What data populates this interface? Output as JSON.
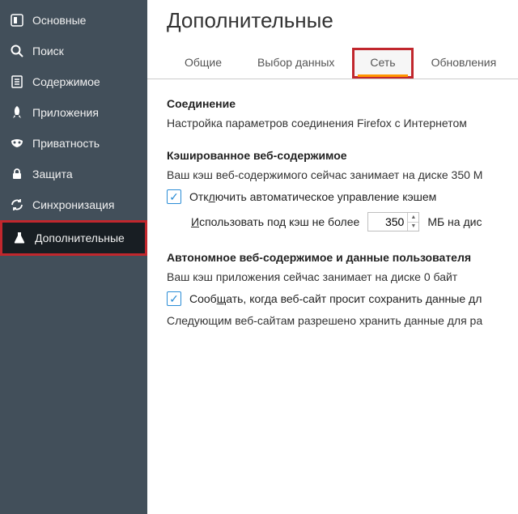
{
  "sidebar": {
    "items": [
      {
        "label": "Основные"
      },
      {
        "label": "Поиск"
      },
      {
        "label": "Содержимое"
      },
      {
        "label": "Приложения"
      },
      {
        "label": "Приватность"
      },
      {
        "label": "Защита"
      },
      {
        "label": "Синхронизация"
      },
      {
        "label": "Дополнительные"
      }
    ]
  },
  "page_title": "Дополнительные",
  "tabs": {
    "items": [
      {
        "label": "Общие"
      },
      {
        "label": "Выбор данных"
      },
      {
        "label": "Сеть"
      },
      {
        "label": "Обновления"
      }
    ]
  },
  "section_connection": {
    "title": "Соединение",
    "text": "Настройка параметров соединения Firefox с Интернетом"
  },
  "section_cache": {
    "title": "Кэшированное веб-содержимое",
    "usage_text": "Ваш кэш веб-содержимого сейчас занимает на диске 350 М",
    "disable_pre": "Отк",
    "disable_u": "л",
    "disable_post": "ючить автоматическое управление кэшем",
    "limit_pre": "",
    "limit_u": "И",
    "limit_post": "спользовать под кэш не более",
    "limit_value": "350",
    "limit_unit": "МБ на дис"
  },
  "section_offline": {
    "title": "Автономное веб-содержимое и данные пользователя",
    "usage_text": "Ваш кэш приложения сейчас занимает на диске 0 байт",
    "notify_pre": "Сооб",
    "notify_u": "щ",
    "notify_post": "ать, когда веб-сайт просит сохранить данные дл",
    "allowed_text": "Следующим веб-сайтам разрешено хранить данные для ра"
  }
}
